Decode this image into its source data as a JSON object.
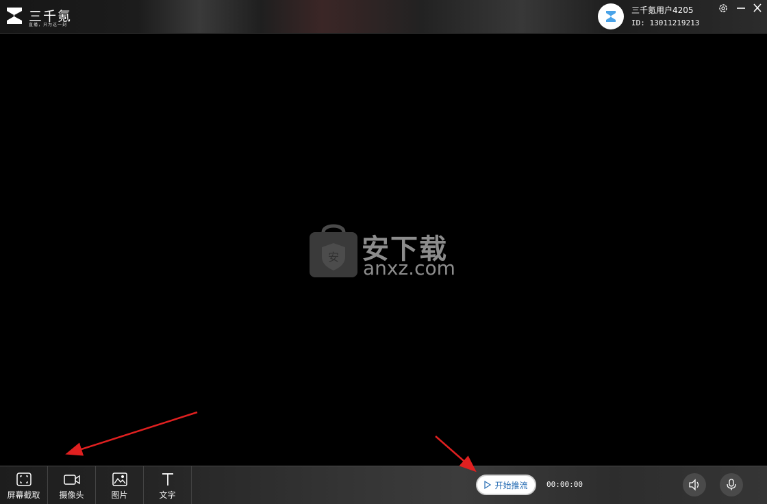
{
  "app": {
    "brand": "三千氪",
    "slogan": "直播，只为这一刻"
  },
  "user": {
    "name": "三千氪用户4205",
    "id": "ID: 13011219213"
  },
  "watermark": {
    "text": "安下载",
    "domain": "anxz.com"
  },
  "toolbar": {
    "tools": [
      {
        "label": "屏幕截取",
        "icon": "screen-capture-icon"
      },
      {
        "label": "摄像头",
        "icon": "camera-icon"
      },
      {
        "label": "图片",
        "icon": "image-icon"
      },
      {
        "label": "文字",
        "icon": "text-icon"
      }
    ],
    "start_label": "开始推流",
    "timer": "00:00:00"
  },
  "colors": {
    "accent": "#2a6fb5",
    "arrow": "#e02020"
  }
}
